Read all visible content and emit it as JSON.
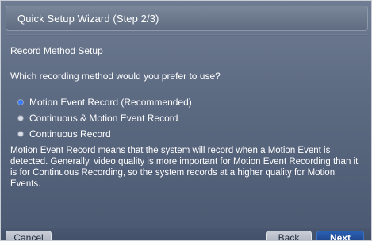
{
  "window": {
    "title": "Quick Setup Wizard (Step 2/3)"
  },
  "content": {
    "section_title": "Record Method Setup",
    "question": "Which recording method would you prefer to use?",
    "options": [
      {
        "label": "Motion Event Record (Recommended)",
        "selected": true
      },
      {
        "label": "Continuous & Motion Event Record",
        "selected": false
      },
      {
        "label": "Continuous Record",
        "selected": false
      }
    ],
    "description": "Motion Event Record means that the system will record when a Motion Event is detected. Generally, video quality is more important for Motion Event Recording than it is for Continuous Recording, so the system records at a higher quality for Motion Events."
  },
  "buttons": {
    "cancel": "Cancel",
    "back": "Back",
    "next": "Next"
  },
  "colors": {
    "background": "#5c6a82",
    "titlebar": "#6f7c92",
    "selected_radio": "#3a7cff",
    "primary_button": "#2b5fb3"
  }
}
